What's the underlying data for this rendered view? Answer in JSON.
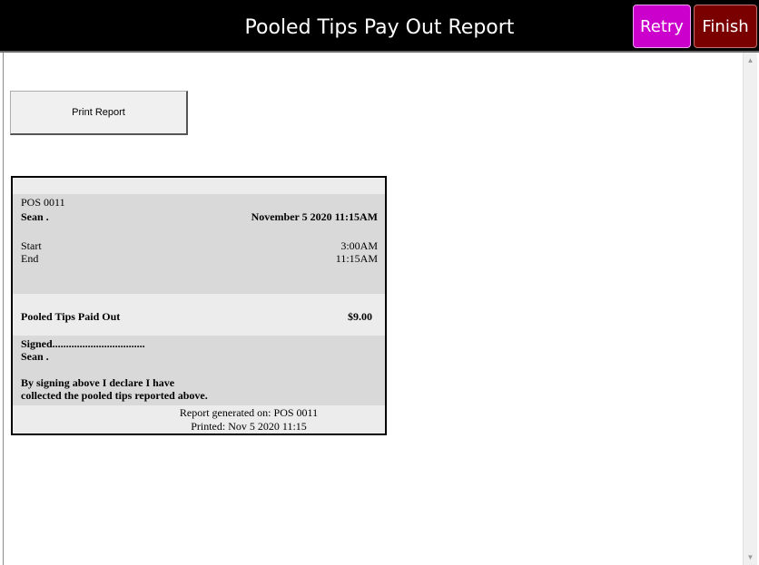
{
  "header": {
    "title": "Pooled Tips Pay Out Report",
    "retry_label": "Retry",
    "finish_label": "Finish",
    "retry_color": "#cc00cc",
    "finish_color": "#7a0000"
  },
  "actions": {
    "print_label": "Print Report"
  },
  "receipt": {
    "terminal": "POS 0011",
    "employee": "Sean .",
    "date": "November 5 2020 11:15AM",
    "start_label": "Start",
    "start_value": "3:00AM",
    "end_label": "End",
    "end_value": "11:15AM",
    "paid_label": "Pooled Tips Paid Out",
    "paid_value": "$9.00",
    "signed_label": "Signed..................................",
    "signer": "Sean .",
    "declaration_line1": "By signing above I declare I have",
    "declaration_line2": "collected the pooled tips reported above.",
    "generated_on": "Report generated on: POS 0011",
    "printed": "Printed: Nov 5 2020  11:15"
  },
  "scrollbar": {
    "up_icon": "triangle-up",
    "down_icon": "triangle-down"
  }
}
